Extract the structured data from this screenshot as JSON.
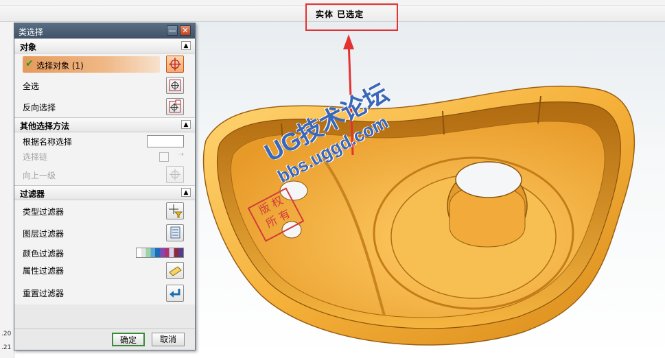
{
  "status_bar": {
    "message": "实体 已选定"
  },
  "left_strip": {
    "numbers": [
      ".20",
      ".21"
    ]
  },
  "dialog": {
    "title": "类选择",
    "minimize_glyph": "—",
    "close_glyph": "✕",
    "sections": {
      "object": {
        "header": "对象",
        "select_objects": "选择对象 (1)",
        "select_all": "全选",
        "invert_selection": "反向选择"
      },
      "other_methods": {
        "header": "其他选择方法",
        "select_by_name": "根据名称选择",
        "select_chain": "选择链",
        "up_one_level": "向上一级"
      },
      "filters": {
        "header": "过滤器",
        "type_filter": "类型过滤器",
        "layer_filter": "图层过滤器",
        "color_filter": "颜色过滤器",
        "attribute_filter": "属性过滤器",
        "reset_filter": "重置过滤器"
      }
    },
    "ok": "确定",
    "cancel": "取消"
  },
  "watermark": {
    "title": "UG技术论坛",
    "url": "bbs.uggd.com",
    "stamp": "版权所有"
  },
  "icons": {
    "collapse": "chevron-up-icon",
    "check": "checkmark-icon",
    "crosshair": "crosshair-icon"
  },
  "colors": {
    "dialog_title": "#4a5e74",
    "selection_highlight": "#e69a5c",
    "model_fill": "#f4b640",
    "annotation_red": "#e23232",
    "watermark_blue": "#3b67b8"
  }
}
